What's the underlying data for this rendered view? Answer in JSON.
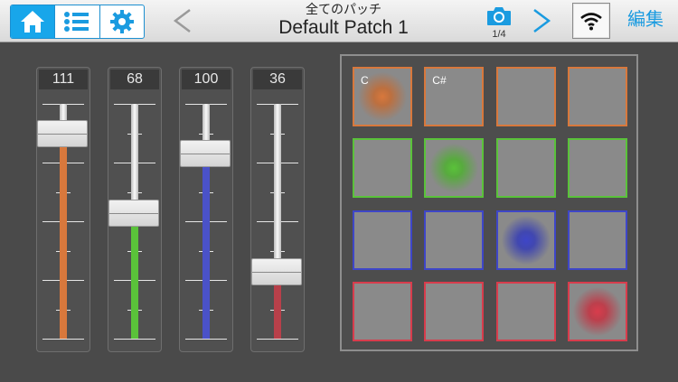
{
  "header": {
    "subtitle": "全てのパッチ",
    "title": "Default Patch 1",
    "snapshot_page": "1/4",
    "edit_label": "編集",
    "accent_color": "#1a9be0",
    "mode_buttons": [
      "home-icon",
      "list-icon",
      "gear-icon"
    ],
    "active_mode": "home"
  },
  "sliders": [
    {
      "value": "111",
      "level": 111,
      "color": "#d8783c"
    },
    {
      "value": "68",
      "level": 68,
      "color": "#5ac23a"
    },
    {
      "value": "100",
      "level": 100,
      "color": "#4a52c8"
    },
    {
      "value": "36",
      "level": 36,
      "color": "#b8404a"
    }
  ],
  "pads": {
    "rows": [
      {
        "color": "#d8783c",
        "cells": [
          {
            "note": "C",
            "active": true
          },
          {
            "note": "C#",
            "active": false
          },
          {
            "note": "",
            "active": false
          },
          {
            "note": "",
            "active": false
          }
        ]
      },
      {
        "color": "#5ac23a",
        "cells": [
          {
            "note": "",
            "active": false
          },
          {
            "note": "",
            "active": true
          },
          {
            "note": "",
            "active": false
          },
          {
            "note": "",
            "active": false
          }
        ]
      },
      {
        "color": "#3e46c8",
        "cells": [
          {
            "note": "",
            "active": false
          },
          {
            "note": "",
            "active": false
          },
          {
            "note": "",
            "active": true
          },
          {
            "note": "",
            "active": false
          }
        ]
      },
      {
        "color": "#d83c4c",
        "cells": [
          {
            "note": "",
            "active": false
          },
          {
            "note": "",
            "active": false
          },
          {
            "note": "",
            "active": false
          },
          {
            "note": "",
            "active": true
          }
        ]
      }
    ]
  }
}
